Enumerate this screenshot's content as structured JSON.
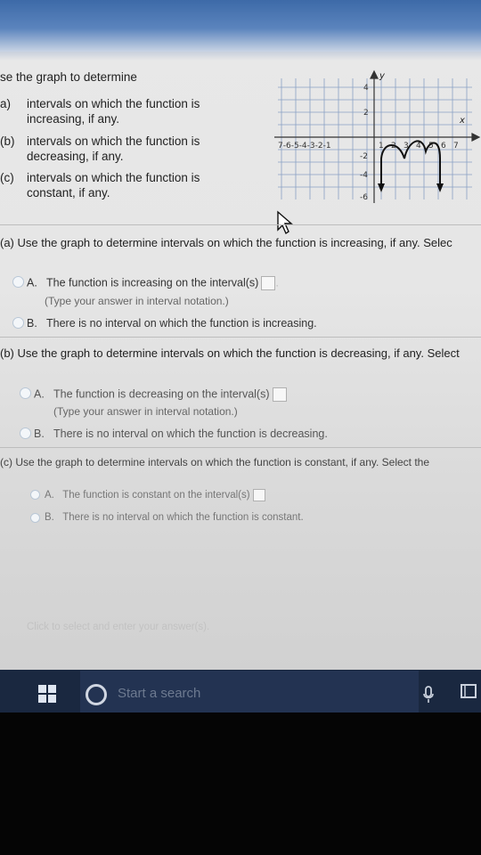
{
  "question": {
    "intro": "se the graph to determine",
    "items": [
      {
        "tag": "a)",
        "text": "intervals on which the function is increasing, if any."
      },
      {
        "tag": "(b)",
        "text": "intervals on which the function is decreasing, if any."
      },
      {
        "tag": "(c)",
        "text": "intervals on which the function is constant, if any."
      }
    ]
  },
  "graph": {
    "y_label": "y",
    "x_label": "x",
    "x_neg_ticks": "7-6-5-4-3-2-1",
    "x_pos_ticks": [
      "1",
      "2",
      "3",
      "4",
      "5",
      "6",
      "7"
    ],
    "y_ticks": [
      "4",
      "2",
      "-2",
      "-4",
      "-6"
    ]
  },
  "parts": [
    {
      "title": "(a) Use the graph to determine intervals on which the function is increasing, if any. Selec",
      "options": [
        {
          "letter": "A.",
          "text": "The function is increasing on the interval(s)",
          "hint": "(Type your answer in interval notation.)"
        },
        {
          "letter": "B.",
          "text": "There is no interval on which the function is increasing."
        }
      ]
    },
    {
      "title": "(b) Use the graph to determine intervals on which the function is decreasing, if any. Select",
      "options": [
        {
          "letter": "A.",
          "text": "The function is decreasing on the interval(s)",
          "hint": "(Type your answer in interval notation.)"
        },
        {
          "letter": "B.",
          "text": "There is no interval on which the function is decreasing."
        }
      ]
    },
    {
      "title": "(c) Use the graph to determine intervals on which the function is constant, if any. Select the",
      "options": [
        {
          "letter": "A.",
          "text": "The function is constant on the interval(s)"
        },
        {
          "letter": "B.",
          "text": "There is no interval on which the function is constant."
        }
      ]
    }
  ],
  "footer_hint": "Click to select and enter your answer(s).",
  "taskbar": {
    "search_placeholder": "Start a search"
  }
}
